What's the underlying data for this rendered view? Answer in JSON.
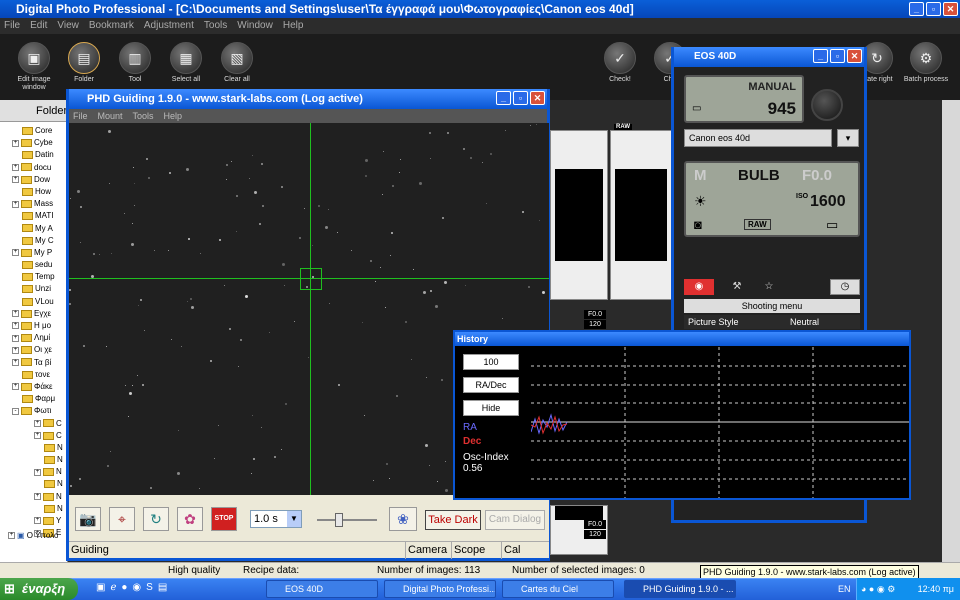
{
  "dpp": {
    "title": "Digital Photo Professional - [C:\\Documents and Settings\\user\\Τα έγγραφά μου\\Φωτογραφίες\\Canon eos 40d]",
    "menu": [
      "File",
      "Edit",
      "View",
      "Bookmark",
      "Adjustment",
      "Tools",
      "Window",
      "Help"
    ],
    "toolbar": [
      {
        "label": "Edit image window",
        "icon": "edit-image-icon"
      },
      {
        "label": "Folder",
        "icon": "folder-icon"
      },
      {
        "label": "Tool",
        "icon": "tool-icon"
      },
      {
        "label": "Select all",
        "icon": "select-all-icon"
      },
      {
        "label": "Clear all",
        "icon": "clear-all-icon"
      }
    ],
    "toolbar_right": [
      {
        "label": "Check!",
        "icon": "check-icon"
      },
      {
        "label": "Che",
        "icon": "check2-icon"
      },
      {
        "label": "otate right",
        "icon": "rotate-right-icon"
      },
      {
        "label": "Batch process",
        "icon": "batch-process-icon"
      }
    ],
    "folder_tab": "Folder",
    "tree": [
      {
        "name": "Core",
        "pm": ""
      },
      {
        "name": "Cybe",
        "pm": "+"
      },
      {
        "name": "Datin",
        "pm": ""
      },
      {
        "name": "docu",
        "pm": "+"
      },
      {
        "name": "Dow",
        "pm": "+"
      },
      {
        "name": "How",
        "pm": ""
      },
      {
        "name": "Mass",
        "pm": "+"
      },
      {
        "name": "MATI",
        "pm": ""
      },
      {
        "name": "My A",
        "pm": ""
      },
      {
        "name": "My C",
        "pm": ""
      },
      {
        "name": "My P",
        "pm": "+"
      },
      {
        "name": "sedu",
        "pm": ""
      },
      {
        "name": "Temp",
        "pm": ""
      },
      {
        "name": "Unzi",
        "pm": ""
      },
      {
        "name": "VLou",
        "pm": ""
      },
      {
        "name": "Εγχε",
        "pm": "+"
      },
      {
        "name": "Η μο",
        "pm": "+"
      },
      {
        "name": "Λημί",
        "pm": "+"
      },
      {
        "name": "Οι χε",
        "pm": "+"
      },
      {
        "name": "Τα βί",
        "pm": "+"
      },
      {
        "name": "τονε",
        "pm": ""
      },
      {
        "name": "Φάκε",
        "pm": "+"
      },
      {
        "name": "Φαρμ",
        "pm": ""
      },
      {
        "name": "Φωτι",
        "pm": "-"
      },
      {
        "name": "C",
        "pm": "+"
      },
      {
        "name": "C",
        "pm": "+"
      },
      {
        "name": "N",
        "pm": ""
      },
      {
        "name": "N",
        "pm": ""
      },
      {
        "name": "N",
        "pm": "+"
      },
      {
        "name": "N",
        "pm": ""
      },
      {
        "name": "N",
        "pm": "+"
      },
      {
        "name": "N",
        "pm": ""
      },
      {
        "name": "Y",
        "pm": "+"
      },
      {
        "name": "E",
        "pm": "+"
      }
    ],
    "tree_bottom": "Ο Υπολο",
    "raw_tag": "RAW",
    "f_tags": [
      "F0.0",
      "120",
      "F0.0",
      "120"
    ],
    "status": {
      "quality": "High quality",
      "recipe": "Recipe data:",
      "images": "Number of images: 113",
      "selected": "Number of selected images: 0"
    }
  },
  "phd": {
    "title": "PHD Guiding 1.9.0  -  www.stark-labs.com (Log active)",
    "menu": [
      "File",
      "Mount",
      "Tools",
      "Help"
    ],
    "exposure": "1.0 s",
    "take_dark": "Take Dark",
    "cam_dialog": "Cam Dialog",
    "status": {
      "state": "Guiding",
      "camera": "Camera",
      "scope": "Scope",
      "cal": "Cal"
    },
    "icons": [
      "camera-icon",
      "telescope-icon",
      "loop-icon",
      "brain-guide-icon",
      "stop-icon",
      "brain-icon"
    ],
    "stop_label": "STOP"
  },
  "eos": {
    "title": "EOS 40D",
    "mode": "MANUAL",
    "shots": "945",
    "camera_name": "Canon eos 40d",
    "mode_letter": "M",
    "shutter": "BULB",
    "aperture": "F0.0",
    "iso_label": "ISO",
    "iso": "1600",
    "quality": "RAW",
    "menu_title": "Shooting menu",
    "menu_row": {
      "label": "Picture Style",
      "value": "Neutral"
    }
  },
  "history": {
    "title": "History",
    "btn_scale": "100",
    "btn_mode": "RA/Dec",
    "btn_hide": "Hide",
    "ra": "RA",
    "dec": "Dec",
    "osc_label": "Osc-Index",
    "osc_value": "0.56",
    "colors": {
      "ra": "#6a6aff",
      "dec": "#e03030"
    }
  },
  "taskbar": {
    "start": "έναρξη",
    "tasks": [
      "EOS 40D",
      "Digital Photo Professi...",
      "Cartes du Ciel",
      "PHD Guiding 1.9.0  -  ..."
    ],
    "lang": "EN",
    "clock": "12:40 πμ"
  },
  "tooltip": "PHD Guiding 1.9.0  -  www.stark-labs.com (Log active)"
}
